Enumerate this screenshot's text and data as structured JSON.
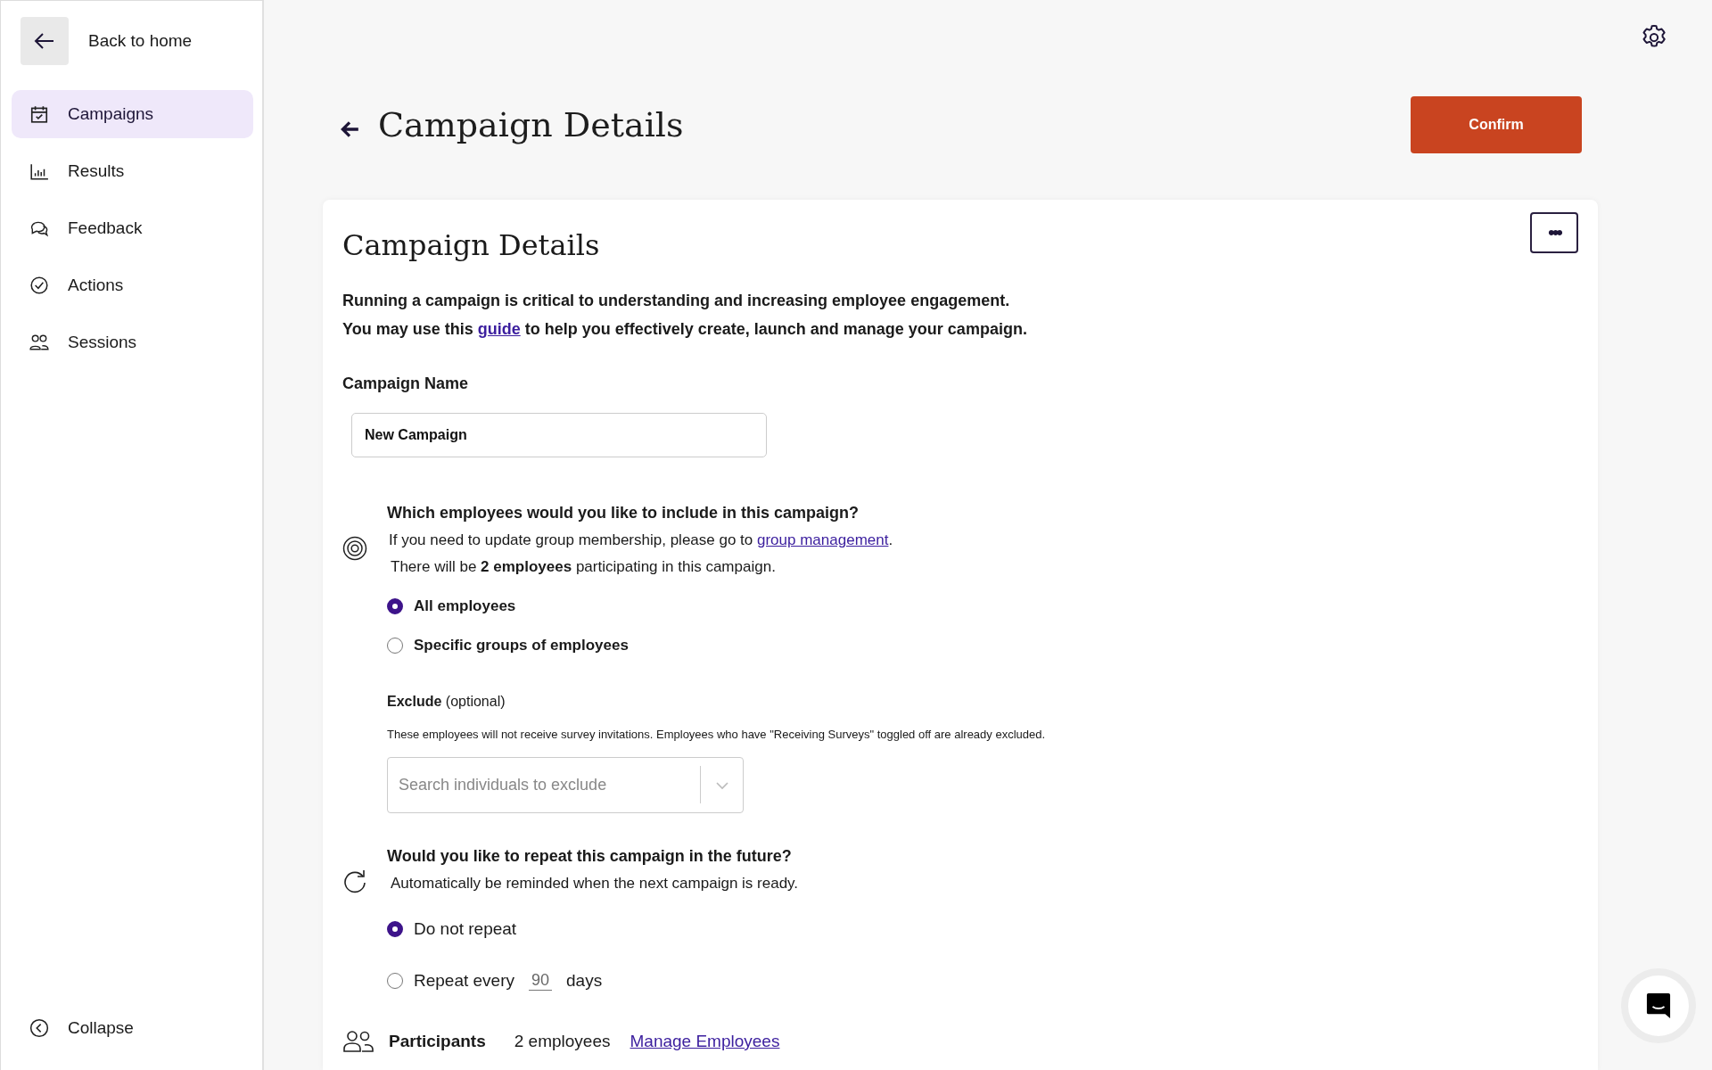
{
  "sidebar": {
    "back": {
      "label": "Back to home"
    },
    "items": [
      {
        "label": "Campaigns",
        "selected": true
      },
      {
        "label": "Results",
        "selected": false
      },
      {
        "label": "Feedback",
        "selected": false
      },
      {
        "label": "Actions",
        "selected": false
      },
      {
        "label": "Sessions",
        "selected": false
      }
    ],
    "collapse": {
      "label": "Collapse"
    }
  },
  "header": {
    "title": "Campaign Details",
    "confirm": "Confirm"
  },
  "card": {
    "title": "Campaign Details",
    "more": "•••",
    "intro": [
      "Running a campaign is critical to understanding and increasing employee engagement.",
      {
        "before": "You may use this ",
        "link": "guide",
        "after": " to help you effectively create, launch and manage your campaign."
      }
    ],
    "name_field": {
      "label": "Campaign Name",
      "value": "New Campaign"
    },
    "employees": {
      "question": "Which employees would you like to include in this campaign?",
      "hint": {
        "before": "If you need to update group membership, please go to ",
        "link": "group management",
        "after": "."
      },
      "count_note": "There will be **2 employees** participating in this campaign.",
      "options": [
        {
          "label": "All employees",
          "selected": true
        },
        {
          "label": "Specific groups of employees",
          "selected": false
        }
      ],
      "exclude_label": "**Exclude** (optional)",
      "exclude_note": "These employees will not receive survey invitations. Employees who have \"Receiving Surveys\" toggled off are already excluded.",
      "exclude_search": {
        "placeholder": "Search individuals to exclude"
      }
    },
    "repeat": {
      "question": "Would you like to repeat this campaign in the future?",
      "hint": "Automatically be reminded when the next campaign is ready.",
      "options": [
        {
          "kind": "plain",
          "label": "Do not repeat",
          "selected": true
        },
        {
          "kind": "interval",
          "label": "Repeat every",
          "value": "90",
          "unit": "days",
          "selected": false
        }
      ]
    },
    "participants": {
      "label": "Participants",
      "count": "2 employees",
      "link": "Manage Employees"
    }
  }
}
